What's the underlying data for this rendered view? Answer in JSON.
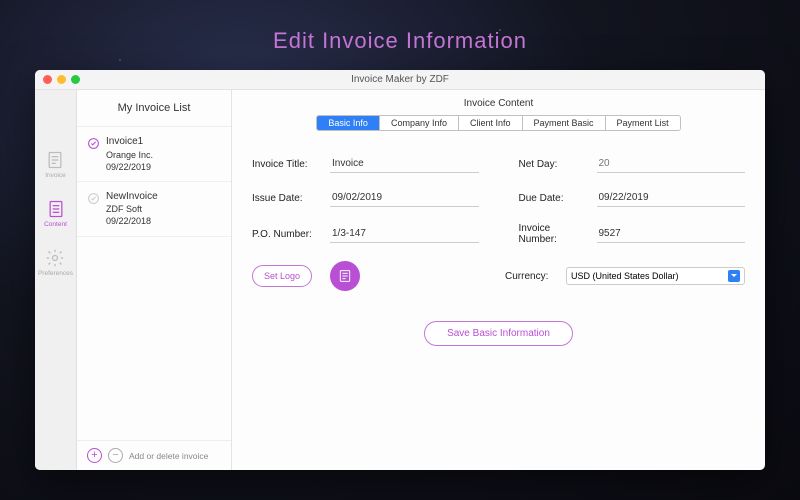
{
  "page_title": "Edit  Invoice  Information",
  "window_title": "Invoice Maker by ZDF",
  "iconbar": {
    "items": [
      {
        "label": "Invoice",
        "active": false
      },
      {
        "label": "Content",
        "active": true
      },
      {
        "label": "Preferences",
        "active": false
      }
    ]
  },
  "sidebar": {
    "header": "My Invoice List",
    "items": [
      {
        "title": "Invoice1",
        "company": "Orange Inc.",
        "date": "09/22/2019",
        "selected": true
      },
      {
        "title": "NewInvoice",
        "company": "ZDF Soft",
        "date": "09/22/2018",
        "selected": false
      }
    ],
    "footer_label": "Add or delete invoice"
  },
  "tabs": {
    "title": "Invoice Content",
    "items": [
      "Basic Info",
      "Company Info",
      "Client Info",
      "Payment Basic",
      "Payment List"
    ],
    "active_index": 0
  },
  "fields": {
    "invoice_title": {
      "label": "Invoice Title:",
      "value": "Invoice"
    },
    "net_day": {
      "label": "Net Day:",
      "placeholder": "20"
    },
    "issue_date": {
      "label": "Issue Date:",
      "value": "09/02/2019"
    },
    "due_date": {
      "label": "Due Date:",
      "value": "09/22/2019"
    },
    "po_number": {
      "label": "P.O. Number:",
      "value": "1/3-147"
    },
    "invoice_number": {
      "label": "Invoice Number:",
      "value": "9527"
    },
    "currency": {
      "label": "Currency:",
      "value": "USD (United States Dollar)"
    }
  },
  "buttons": {
    "set_logo": "Set Logo",
    "save": "Save Basic Information"
  }
}
